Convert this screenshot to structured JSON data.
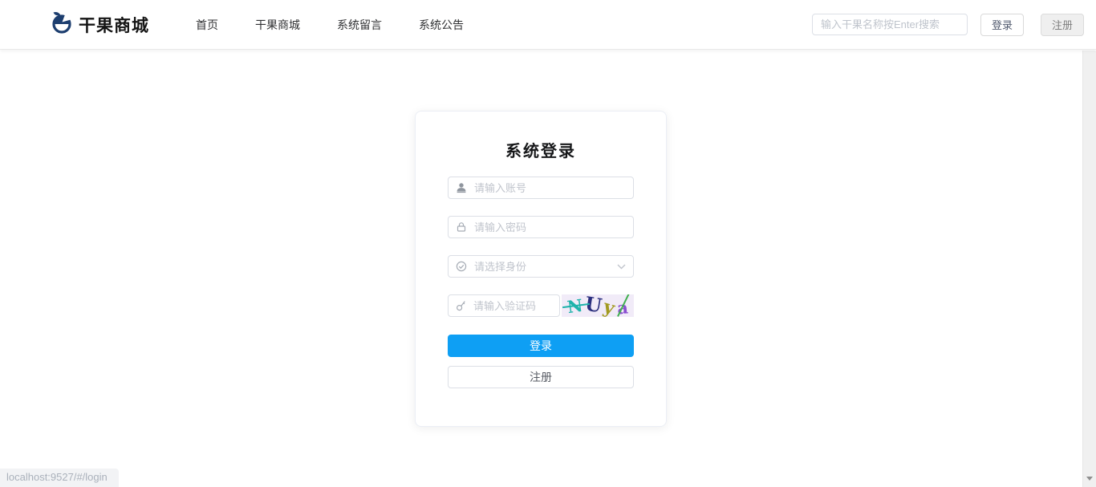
{
  "colors": {
    "primary": "#0e9ff4",
    "logo-navy": "#1d3e6f",
    "captcha-teal": "#1fb3ab",
    "captcha-navy": "#2b2f7e",
    "captcha-olive": "#a29a20",
    "captcha-purple": "#8a4fd0",
    "captcha-green": "#3faf4e"
  },
  "header": {
    "logo_text": "干果商城",
    "nav": [
      {
        "label": "首页"
      },
      {
        "label": "干果商城"
      },
      {
        "label": "系统留言"
      },
      {
        "label": "系统公告"
      }
    ],
    "search_placeholder": "输入干果名称按Enter搜索",
    "login_button_label": "登录",
    "register_button_label": "注册"
  },
  "login_card": {
    "title": "系统登录",
    "account_placeholder": "请输入账号",
    "password_placeholder": "请输入密码",
    "identity_placeholder": "请选择身份",
    "captcha_placeholder": "请输入验证码",
    "captcha_chars": [
      "N",
      "U",
      "y",
      "a"
    ],
    "login_button_label": "登录",
    "register_button_label": "注册"
  },
  "status_bar": {
    "link_preview": "localhost:9527/#/login"
  },
  "icons": {
    "logo": "acorn-icon",
    "account": "user-icon",
    "password": "lock-icon",
    "identity": "circle-check-icon",
    "captcha": "key-icon",
    "identity_arrow": "chevron-down-icon",
    "scrollbar_arrow": "scroll-down-arrow"
  }
}
